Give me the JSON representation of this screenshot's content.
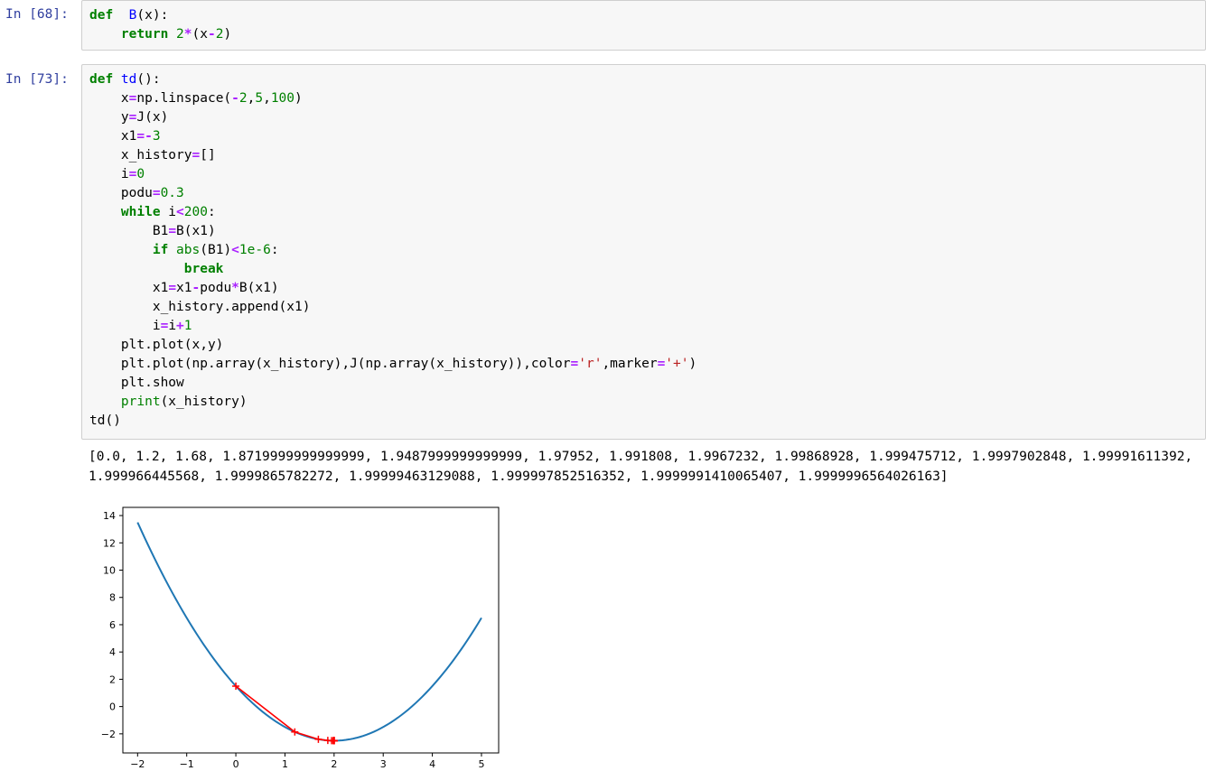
{
  "cells": [
    {
      "prompt": "In  [68]:",
      "lines": [
        [
          [
            "kw",
            "def"
          ],
          [
            "",
            "  "
          ],
          [
            "fn",
            "B"
          ],
          [
            "",
            "(x):"
          ]
        ],
        [
          [
            "",
            "    "
          ],
          [
            "kw",
            "return"
          ],
          [
            "",
            " "
          ],
          [
            "num",
            "2"
          ],
          [
            "op",
            "*"
          ],
          [
            "",
            "(x"
          ],
          [
            "op",
            "-"
          ],
          [
            "num",
            "2"
          ],
          [
            "",
            ")"
          ]
        ]
      ]
    },
    {
      "prompt": "In  [73]:",
      "lines": [
        [
          [
            "kw",
            "def"
          ],
          [
            "",
            ""
          ],
          [
            "fn",
            " td"
          ],
          [
            "",
            "():"
          ]
        ],
        [
          [
            "",
            "    x"
          ],
          [
            "op",
            "="
          ],
          [
            "",
            "np.linspace("
          ],
          [
            "op",
            "-"
          ],
          [
            "num",
            "2"
          ],
          [
            "",
            ","
          ],
          [
            "num",
            "5"
          ],
          [
            "",
            ","
          ],
          [
            "num",
            "100"
          ],
          [
            "",
            ")"
          ]
        ],
        [
          [
            "",
            "    y"
          ],
          [
            "op",
            "="
          ],
          [
            "",
            "J(x)"
          ]
        ],
        [
          [
            "",
            "    x1"
          ],
          [
            "op",
            "=-"
          ],
          [
            "num",
            "3"
          ]
        ],
        [
          [
            "",
            "    x_history"
          ],
          [
            "op",
            "="
          ],
          [
            "",
            "[]"
          ]
        ],
        [
          [
            "",
            "    i"
          ],
          [
            "op",
            "="
          ],
          [
            "num",
            "0"
          ]
        ],
        [
          [
            "",
            "    podu"
          ],
          [
            "op",
            "="
          ],
          [
            "num",
            "0.3"
          ]
        ],
        [
          [
            "",
            "    "
          ],
          [
            "kw",
            "while"
          ],
          [
            "",
            " i"
          ],
          [
            "op",
            "<"
          ],
          [
            "num",
            "200"
          ],
          [
            "",
            ":"
          ]
        ],
        [
          [
            "",
            "        B1"
          ],
          [
            "op",
            "="
          ],
          [
            "",
            "B(x1)"
          ]
        ],
        [
          [
            "",
            "        "
          ],
          [
            "kw",
            "if"
          ],
          [
            "",
            " "
          ],
          [
            "bi",
            "abs"
          ],
          [
            "",
            "(B1)"
          ],
          [
            "op",
            "<"
          ],
          [
            "num",
            "1e-6"
          ],
          [
            "",
            ":"
          ]
        ],
        [
          [
            "",
            "            "
          ],
          [
            "kw",
            "break"
          ]
        ],
        [
          [
            "",
            "        x1"
          ],
          [
            "op",
            "="
          ],
          [
            "",
            "x1"
          ],
          [
            "op",
            "-"
          ],
          [
            "",
            "podu"
          ],
          [
            "op",
            "*"
          ],
          [
            "",
            "B(x1)"
          ]
        ],
        [
          [
            "",
            "        x_history.append(x1)"
          ]
        ],
        [
          [
            "",
            "        i"
          ],
          [
            "op",
            "="
          ],
          [
            "",
            "i"
          ],
          [
            "op",
            "+"
          ],
          [
            "num",
            "1"
          ]
        ],
        [
          [
            "",
            "    plt.plot(x,y)"
          ]
        ],
        [
          [
            "",
            "    plt.plot(np.array(x_history),J(np.array(x_history)),color"
          ],
          [
            "op",
            "="
          ],
          [
            "str",
            "'r'"
          ],
          [
            "",
            ",marker"
          ],
          [
            "op",
            "="
          ],
          [
            "str",
            "'+'"
          ],
          [
            "",
            ")"
          ]
        ],
        [
          [
            "",
            "    plt.show"
          ]
        ],
        [
          [
            "",
            "    "
          ],
          [
            "bi",
            "print"
          ],
          [
            "",
            "(x_history)"
          ]
        ],
        [
          [
            "",
            "td()"
          ]
        ]
      ]
    }
  ],
  "output": {
    "line1": "[0.0, 1.2, 1.68, 1.8719999999999999, 1.9487999999999999, 1.97952, 1.991808, 1.9967232, 1.99868928, 1.999475712, 1.9997902848, 1.99991611392,",
    "line2": "1.999966445568, 1.9999865782272, 1.99999463129088, 1.999997852516352, 1.9999991410065407, 1.9999996564026163]"
  },
  "chart_data": {
    "type": "line",
    "xlim": [
      -2.3,
      5.35
    ],
    "ylim": [
      -3.4,
      14.6
    ],
    "xticks": [
      -2,
      -1,
      0,
      1,
      2,
      3,
      4,
      5
    ],
    "yticks": [
      -2,
      0,
      2,
      4,
      6,
      8,
      10,
      12,
      14
    ],
    "xtick_labels": [
      "−2",
      "−1",
      "0",
      "1",
      "2",
      "3",
      "4",
      "5"
    ],
    "ytick_labels": [
      "−2",
      "0",
      "2",
      "4",
      "6",
      "8",
      "10",
      "12",
      "14"
    ],
    "series": [
      {
        "function": "(x-2)^2 - 2.5",
        "x_range": [
          -2,
          5
        ],
        "n": 100,
        "color": "#1f77b4"
      },
      {
        "x": [
          0.0,
          1.2,
          1.68,
          1.872,
          1.9488,
          1.97952,
          1.991808,
          1.9967232,
          1.99868928,
          1.999475712,
          1.9997902848,
          1.99991611392,
          1.999966445568,
          1.9999865782272,
          1.99999463129088,
          1.999997852516352,
          1.9999991410065407,
          1.9999996564026163
        ],
        "color": "#ff0000",
        "marker": "+"
      }
    ]
  }
}
